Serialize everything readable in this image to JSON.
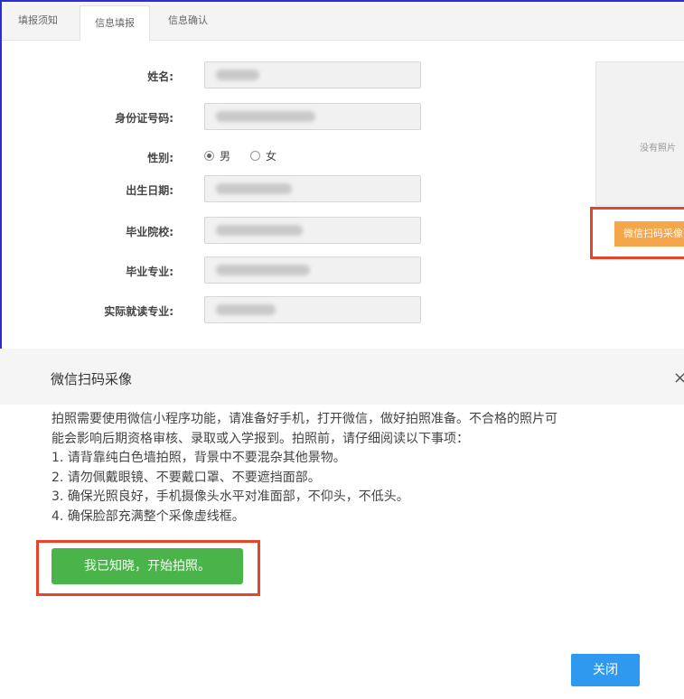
{
  "tabs": [
    "填报须知",
    "信息填报",
    "信息确认"
  ],
  "form": {
    "fields": [
      {
        "label": "姓名:"
      },
      {
        "label": "身份证号码:"
      },
      {
        "label": "出生日期:"
      },
      {
        "label": "毕业院校:"
      },
      {
        "label": "毕业专业:"
      },
      {
        "label": "实际就读专业:"
      }
    ],
    "gender": {
      "label": "性别:",
      "options": [
        "男",
        "女"
      ],
      "selected": "男"
    }
  },
  "photo": {
    "placeholder": "没有照片",
    "button": "微信扫码采像"
  },
  "modal": {
    "title": "微信扫码采像",
    "close_x": "×",
    "paragraph_lines": [
      "拍照需要使用微信小程序功能，请准备好手机，打开微信，做好拍照准备。不合格的照片可",
      "能会影响后期资格审核、录取或入学报到。拍照前，请仔细阅读以下事项："
    ],
    "rules": [
      "1. 请背靠纯白色墙拍照，背景中不要混杂其他景物。",
      "2. 请勿佩戴眼镜、不要戴口罩、不要遮挡面部。",
      "3. 确保光照良好，手机摄像头水平对准面部，不仰头，不低头。",
      "4. 确保脸部充满整个采像虚线框。"
    ],
    "start_button": "我已知晓，开始拍照。",
    "close_button": "关闭"
  },
  "colors": {
    "accent_blue": "#2f98ef",
    "start_green": "#4ab34a",
    "highlight_red": "#e8442a",
    "wx_orange": "#f5a54a"
  }
}
